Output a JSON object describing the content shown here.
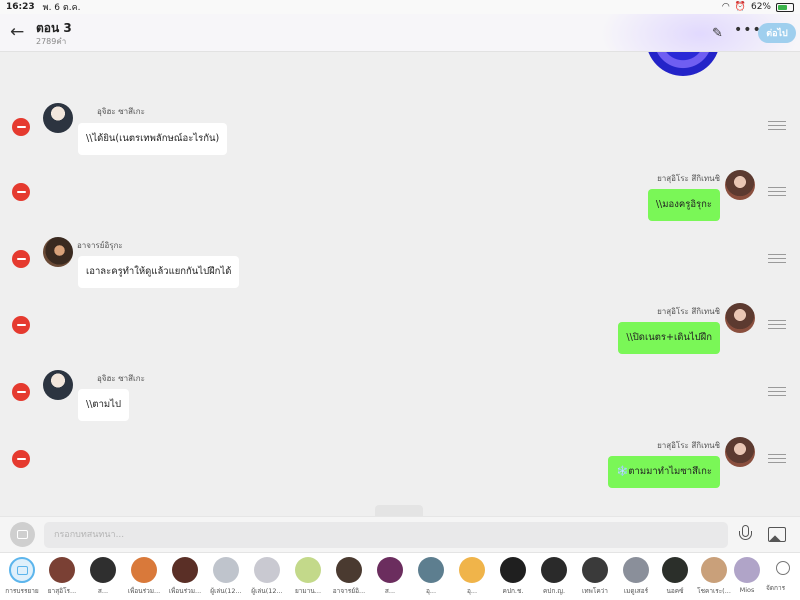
{
  "status_bar": {
    "time": "16:23",
    "date": "พ. 6 ต.ค.",
    "battery": "62%",
    "battery_level": 0.62
  },
  "header": {
    "title": "ตอน 3",
    "subtitle": "2789คำ",
    "next_label": "ต่อไป",
    "back_icon": "back-arrow-icon",
    "edit_icon": "pencil-icon",
    "more_icon": "more-icon"
  },
  "messages": [
    {
      "side": "left",
      "name": "อุจิฮะ ซาสึเกะ",
      "text": "\\\\ได้ยิน(เนตรเทพลักษณ์อะไรกัน)",
      "avatar": "sasuke"
    },
    {
      "side": "right",
      "name": "ยาสุอิโระ สึกิเทนชิ",
      "text": "\\\\มองครูอิรุกะ",
      "avatar": "itachi"
    },
    {
      "side": "left",
      "name": "อาจารย์อิรุกะ",
      "text": "เอาละครูทำให้ดูแล้วแยกกันไปฝึกได้",
      "avatar": "teacher"
    },
    {
      "side": "right",
      "name": "ยาสุอิโระ สึกิเทนชิ",
      "text": "\\\\ปิดเนตร+เดินไปฝึก",
      "avatar": "itachi"
    },
    {
      "side": "left",
      "name": "อุจิฮะ ซาสึเกะ",
      "text": "\\\\ตามไป",
      "avatar": "sasuke"
    },
    {
      "side": "right",
      "name": "ยาสุอิโระ สึกิเทนชิ",
      "text": "❄️ตามมาทำไมซาสึเกะ",
      "avatar": "itachi"
    }
  ],
  "input": {
    "placeholder": "กรอกบทสนทนา..."
  },
  "characters": [
    {
      "name": "การบรรยาย",
      "color": "#dff0fb",
      "selected": true
    },
    {
      "name": "ยาสุอิโร...",
      "color": "#7a4034"
    },
    {
      "name": "ส...",
      "color": "#2f2f2f"
    },
    {
      "name": "เพื่อนร่วม...",
      "color": "#d9793a"
    },
    {
      "name": "เพื่อนร่วม...",
      "color": "#5a2f26"
    },
    {
      "name": "ผู้เล่น(12...",
      "color": "#bfc4cc"
    },
    {
      "name": "ผู้เล่น(12...",
      "color": "#c9c9d1"
    },
    {
      "name": "ยามาน...",
      "color": "#c3d98a"
    },
    {
      "name": "อาจารย์อิ...",
      "color": "#4a3a30"
    },
    {
      "name": "ส...",
      "color": "#6b2d5e"
    },
    {
      "name": "อุ...",
      "color": "#5d7e8f"
    },
    {
      "name": "อุ...",
      "color": "#f0b44a"
    },
    {
      "name": "คปก.ช.",
      "color": "#1f1f1f"
    },
    {
      "name": "คปก.ญ.",
      "color": "#2a2a2a"
    },
    {
      "name": "เทพโคว่า",
      "color": "#3a3a3a"
    },
    {
      "name": "เมดูเสอร์",
      "color": "#8a8f9a"
    },
    {
      "name": "นอคซ์",
      "color": "#2b2f2a"
    },
    {
      "name": "โชคาเระ(...",
      "color": "#c9a07a"
    },
    {
      "name": "Mios",
      "color": "#b0a4c8"
    }
  ],
  "manage_label": "จัดการ"
}
